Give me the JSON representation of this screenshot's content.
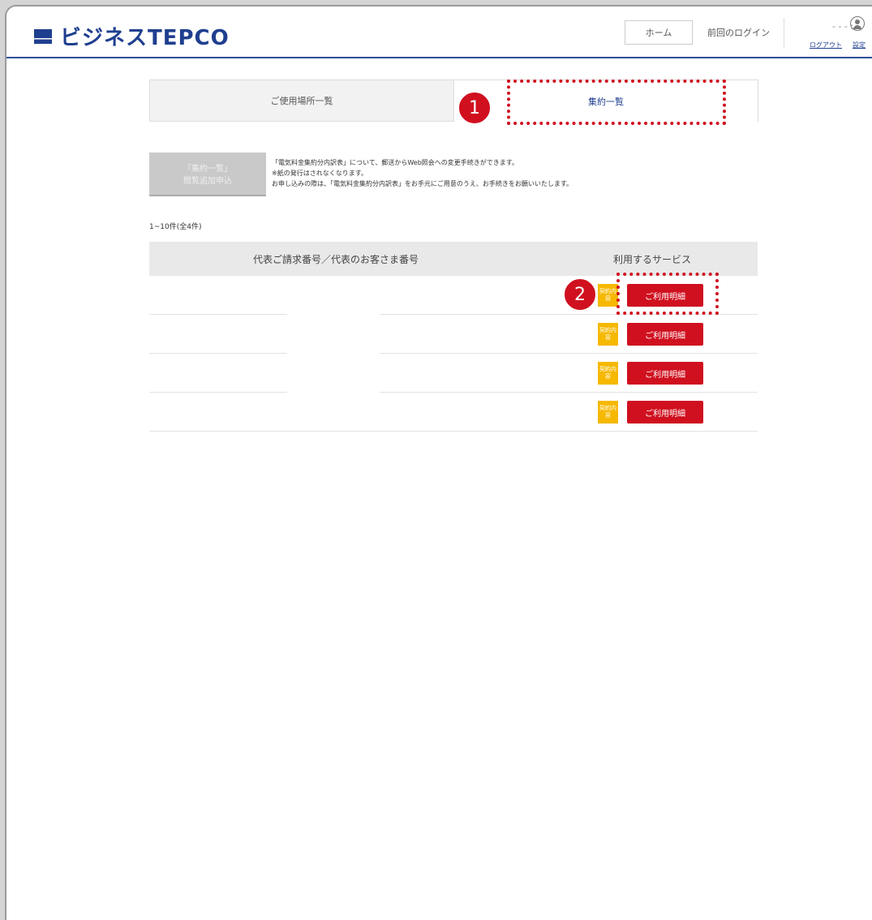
{
  "header": {
    "logo_text": "ビジネスTEPCO",
    "home_label": "ホーム",
    "last_login_label": "前回のログイン",
    "user_mask": "- - - :",
    "logout_label": "ログアウト",
    "settings_label": "設定"
  },
  "tabs": [
    {
      "label": "ご使用場所一覧"
    },
    {
      "label": "集約一覧"
    }
  ],
  "annotations": [
    "1",
    "2"
  ],
  "request": {
    "button_line1": "「集約一覧」",
    "button_line2": "閲覧追加申込",
    "text_line1": "「電気料金集約分内訳表」について、郵送からWeb照会への変更手続きができます。",
    "text_line2": "※紙の発行はされなくなります。",
    "text_line3": "お申し込みの際は、「電気料金集約分内訳表」をお手元にご用意のうえ、お手続きをお願いいたします。"
  },
  "result_count": "1~10件(全4件)",
  "table": {
    "headers": [
      "代表ご請求番号／代表のお客さま番号",
      "利用するサービス"
    ],
    "rows": [
      {
        "keiyaku": "契約内容",
        "meisai": "ご利用明細"
      },
      {
        "keiyaku": "契約内容",
        "meisai": "ご利用明細"
      },
      {
        "keiyaku": "契約内容",
        "meisai": "ご利用明細"
      },
      {
        "keiyaku": "契約内容",
        "meisai": "ご利用明細"
      }
    ]
  },
  "colors": {
    "brand_blue": "#1f3f8f",
    "accent_red": "#d0101f",
    "badge_yellow": "#f6b800"
  }
}
